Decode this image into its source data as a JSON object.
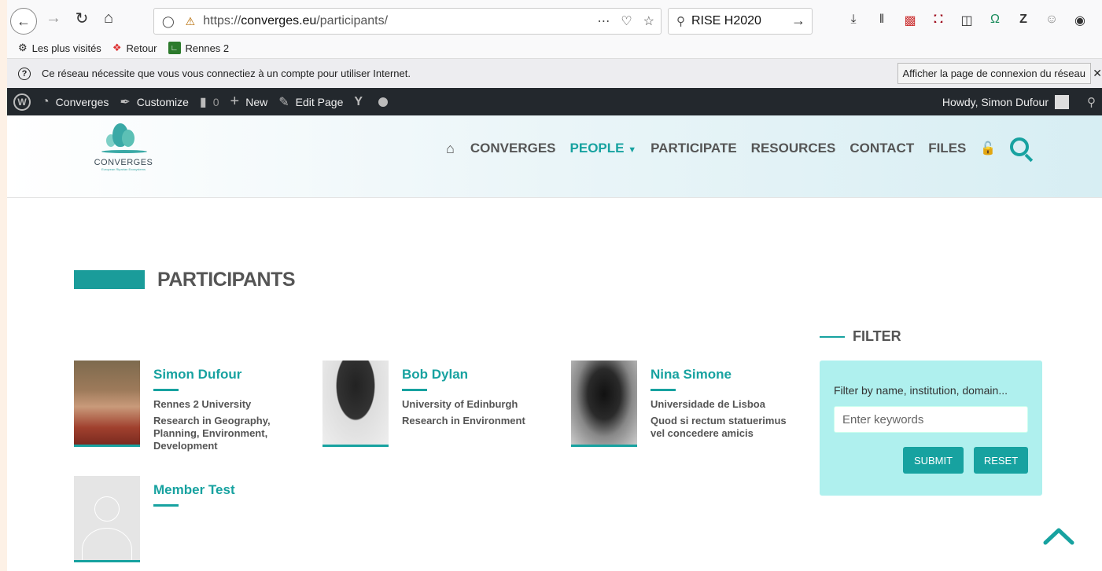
{
  "browser": {
    "url_prefix": "https://",
    "url_domain": "converges.eu",
    "url_path": "/participants/",
    "search_value": "RISE H2020",
    "bookmarks": [
      {
        "label": "Les plus visités"
      },
      {
        "label": "Retour"
      },
      {
        "label": "Rennes 2"
      }
    ],
    "notice_text": "Ce réseau nécessite que vous vous connectiez à un compte pour utiliser Internet.",
    "notice_button": "Afficher la page de connexion du réseau"
  },
  "adminbar": {
    "site": "Converges",
    "customize": "Customize",
    "comments": "0",
    "new": "New",
    "edit": "Edit Page",
    "howdy": "Howdy, Simon Dufour"
  },
  "site": {
    "logo_name": "CONVERGES",
    "logo_sub": "European Riparian Ecosystems",
    "nav": [
      "CONVERGES",
      "PEOPLE",
      "PARTICIPATE",
      "RESOURCES",
      "CONTACT",
      "FILES"
    ]
  },
  "page": {
    "title": "PARTICIPANTS"
  },
  "members": [
    {
      "name": "Simon Dufour",
      "institution": "Rennes 2 University",
      "description": "Research in Geography, Planning, Environment, Development"
    },
    {
      "name": "Bob Dylan",
      "institution": "University of Edinburgh",
      "description": "Research in Environment"
    },
    {
      "name": "Nina Simone",
      "institution": "Universidade de Lisboa",
      "description": "Quod si rectum statuerimus vel concedere amicis"
    },
    {
      "name": "Member Test",
      "institution": "",
      "description": ""
    }
  ],
  "filter": {
    "heading": "FILTER",
    "label": "Filter by name, institution, domain...",
    "placeholder": "Enter keywords",
    "submit": "SUBMIT",
    "reset": "RESET"
  },
  "colors": {
    "accent": "#17a2a0",
    "filter_bg": "#aff0ee",
    "adminbar": "#23282d"
  }
}
